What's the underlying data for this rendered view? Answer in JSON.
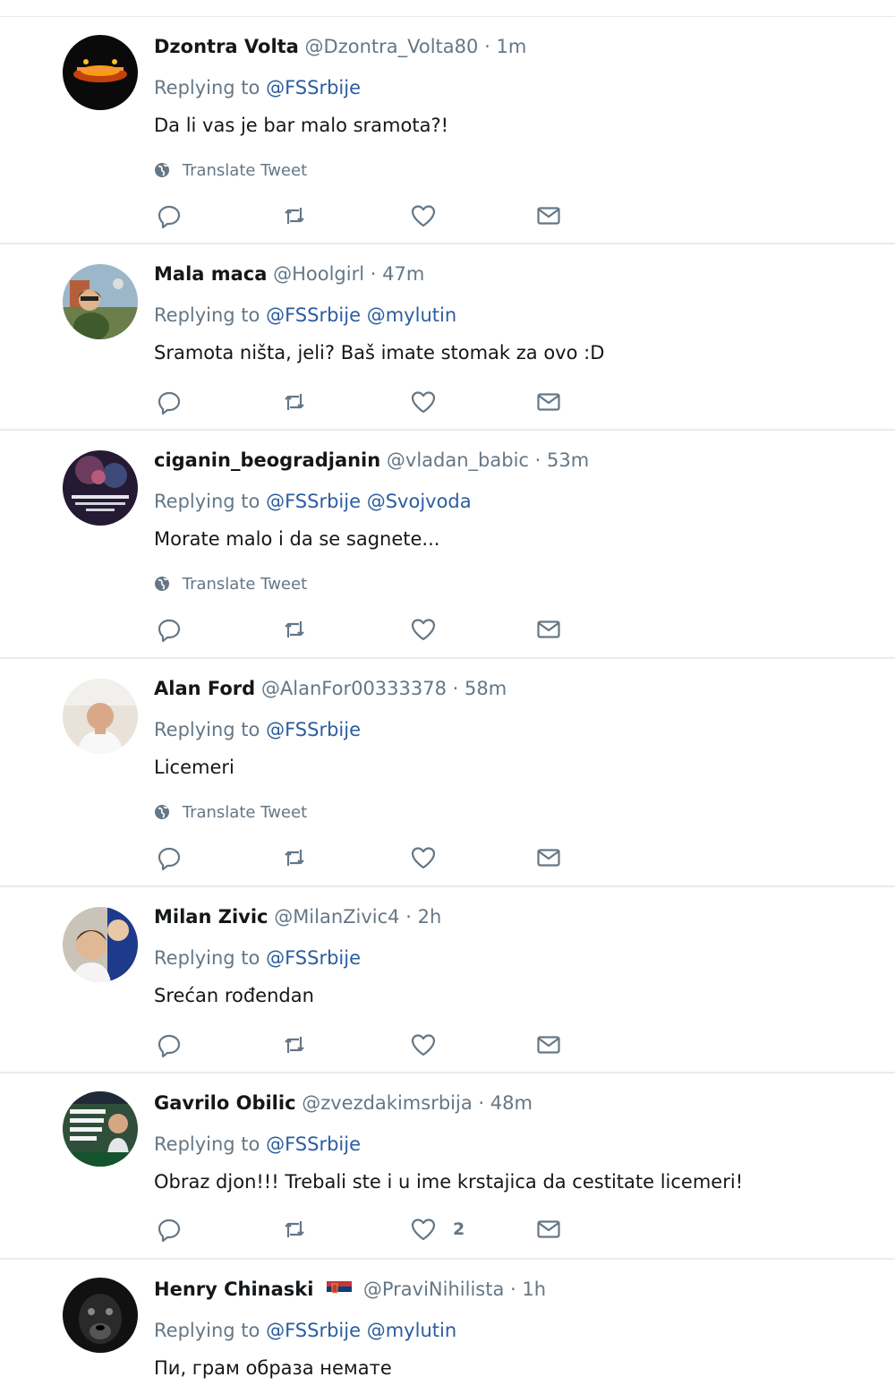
{
  "translate_label": "Translate Tweet",
  "replying_to_label": "Replying to",
  "colors": {
    "link": "#2b5d9e",
    "muted": "#657786",
    "text": "#14171a",
    "divider": "#e6ecf0"
  },
  "tweets": [
    {
      "name": "Dzontra Volta",
      "handle": "@Dzontra_Volta80",
      "time": "1m",
      "mentions": [
        "@FSSrbije"
      ],
      "text": "Da li vas je bar malo sramota?!",
      "translate": true,
      "likes": ""
    },
    {
      "name": "Mala maca",
      "handle": "@Hoolgirl",
      "time": "47m",
      "mentions": [
        "@FSSrbije",
        "@mylutin"
      ],
      "text": "Sramota ništa, jeli? Baš imate stomak za ovo :D",
      "translate": false,
      "likes": ""
    },
    {
      "name": "ciganin_beogradjanin",
      "handle": "@vladan_babic",
      "time": "53m",
      "mentions": [
        "@FSSrbije",
        "@Svojvoda"
      ],
      "text": "Morate malo i da se sagnete...",
      "translate": true,
      "likes": ""
    },
    {
      "name": "Alan Ford",
      "handle": "@AlanFor00333378",
      "time": "58m",
      "mentions": [
        "@FSSrbije"
      ],
      "text": "Licemeri",
      "translate": true,
      "likes": ""
    },
    {
      "name": "Milan Zivic",
      "handle": "@MilanZivic4",
      "time": "2h",
      "mentions": [
        "@FSSrbije"
      ],
      "text": "Srećan rođendan",
      "translate": false,
      "likes": ""
    },
    {
      "name": "Gavrilo Obilic",
      "handle": "@zvezdakimsrbija",
      "time": "48m",
      "mentions": [
        "@FSSrbije"
      ],
      "text": "Obraz djon!!! Trebali ste i u ime krstajica da cestitate licemeri!",
      "translate": false,
      "likes": "2"
    },
    {
      "name": "Henry Chinaski",
      "handle": "@PraviNihilista",
      "time": "1h",
      "mentions": [
        "@FSSrbije",
        "@mylutin"
      ],
      "text": "Пи, грам образа немате",
      "translate": false,
      "likes": ""
    }
  ]
}
